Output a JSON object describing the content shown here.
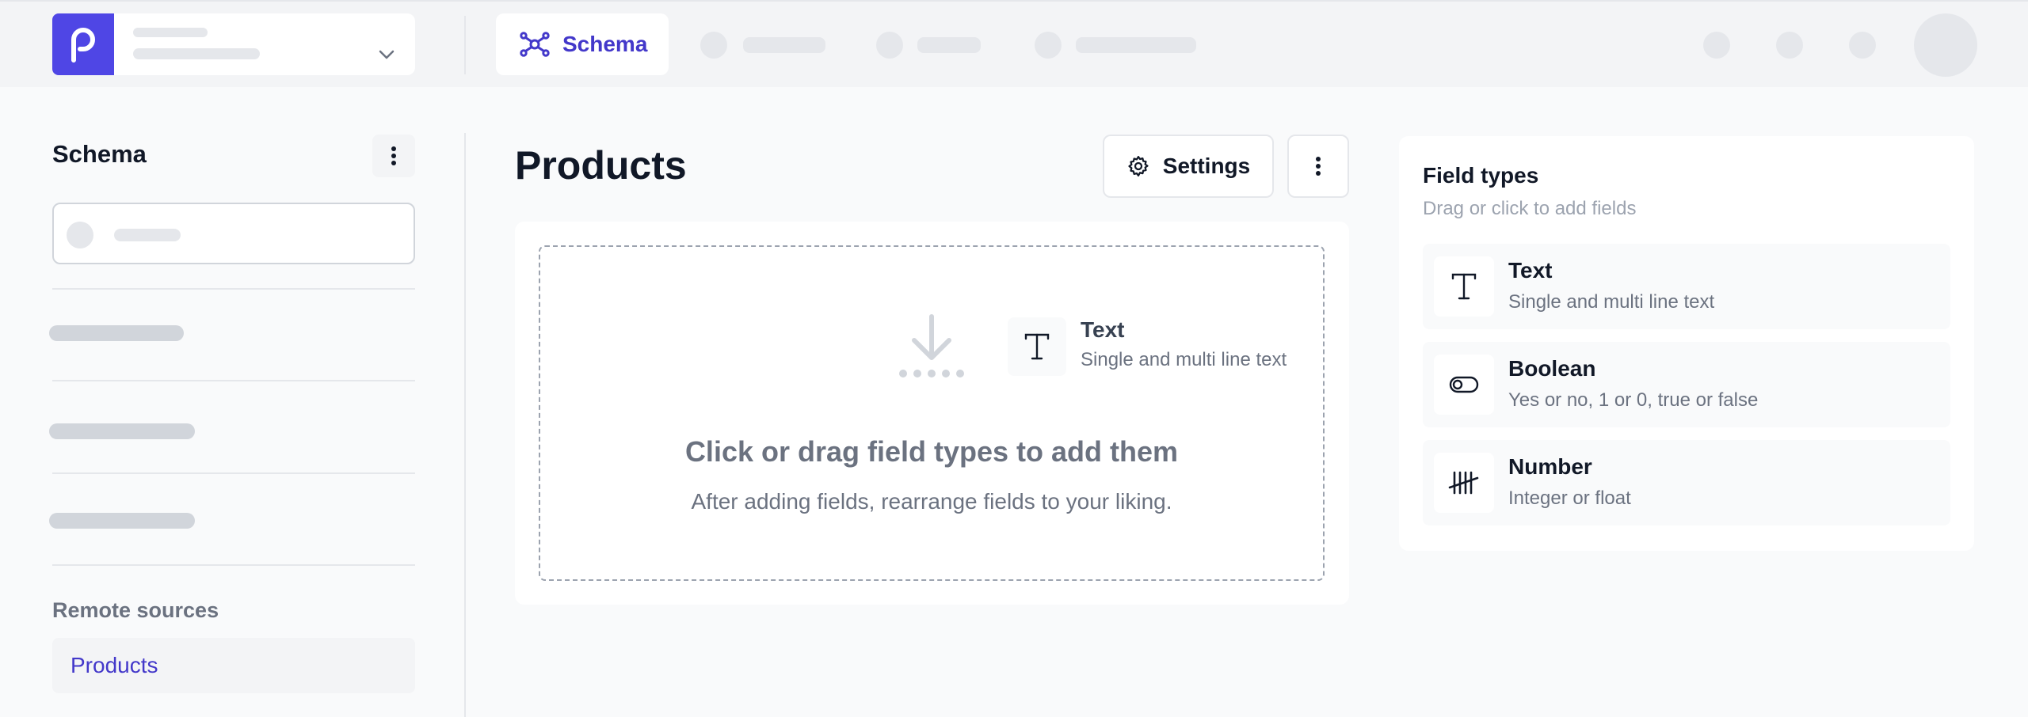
{
  "header": {
    "active_tab": "Schema",
    "icons": {
      "logo": "p-logo-icon",
      "schema": "schema-graph-icon",
      "dropdown": "chevron-down-icon"
    }
  },
  "sidebar": {
    "title": "Schema",
    "remote_sources_label": "Remote sources",
    "remote_sources": [
      {
        "label": "Products"
      }
    ]
  },
  "main": {
    "title": "Products",
    "settings_label": "Settings",
    "dropzone": {
      "title": "Click or drag field types to add them",
      "subtitle": "After adding fields, rearrange fields to your liking.",
      "icon": "drop-arrow-icon"
    },
    "dragging_item": {
      "name": "Text",
      "description": "Single and multi line text",
      "icon": "text-type-icon"
    }
  },
  "field_types": {
    "title": "Field types",
    "subtitle": "Drag or click to add fields",
    "items": [
      {
        "name": "Text",
        "description": "Single and multi line text",
        "icon": "text-type-icon"
      },
      {
        "name": "Boolean",
        "description": "Yes or no, 1 or 0, true or false",
        "icon": "toggle-icon"
      },
      {
        "name": "Number",
        "description": "Integer or float",
        "icon": "tally-icon"
      }
    ]
  },
  "colors": {
    "accent": "#4f46e5",
    "accent_text": "#4338ca",
    "topbar_bg": "#f3f4f6",
    "page_bg": "#f9fafb",
    "skeleton": "#e5e7eb"
  }
}
